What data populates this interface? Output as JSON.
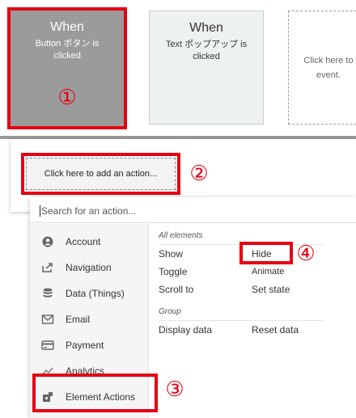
{
  "cards": [
    {
      "title": "When",
      "sub": "Button ボタン is\nclicked"
    },
    {
      "title": "When",
      "sub": "Text ポップアップ is\nclicked"
    },
    {
      "title": "",
      "sub": "Click here to\nevent."
    }
  ],
  "add_action_label": "Click here to add an action...",
  "search": {
    "placeholder": "Search for an action..."
  },
  "categories": [
    {
      "label": "Account",
      "icon": "account-icon"
    },
    {
      "label": "Navigation",
      "icon": "navigation-icon"
    },
    {
      "label": "Data (Things)",
      "icon": "database-icon"
    },
    {
      "label": "Email",
      "icon": "email-icon"
    },
    {
      "label": "Payment",
      "icon": "payment-icon"
    },
    {
      "label": "Analytics",
      "icon": "analytics-icon"
    },
    {
      "label": "Element Actions",
      "icon": "element-actions-icon"
    }
  ],
  "groups": [
    {
      "heading": "All elements",
      "items": [
        "Show",
        "Hide",
        "Toggle",
        "Animate",
        "Scroll to",
        "Set state"
      ]
    },
    {
      "heading": "Group",
      "items": [
        "Display data",
        "Reset data"
      ]
    }
  ],
  "annotations": [
    "①",
    "②",
    "③",
    "④"
  ],
  "colors": {
    "annotation_red": "#e60012",
    "selected_card": "#9b9b9b"
  }
}
